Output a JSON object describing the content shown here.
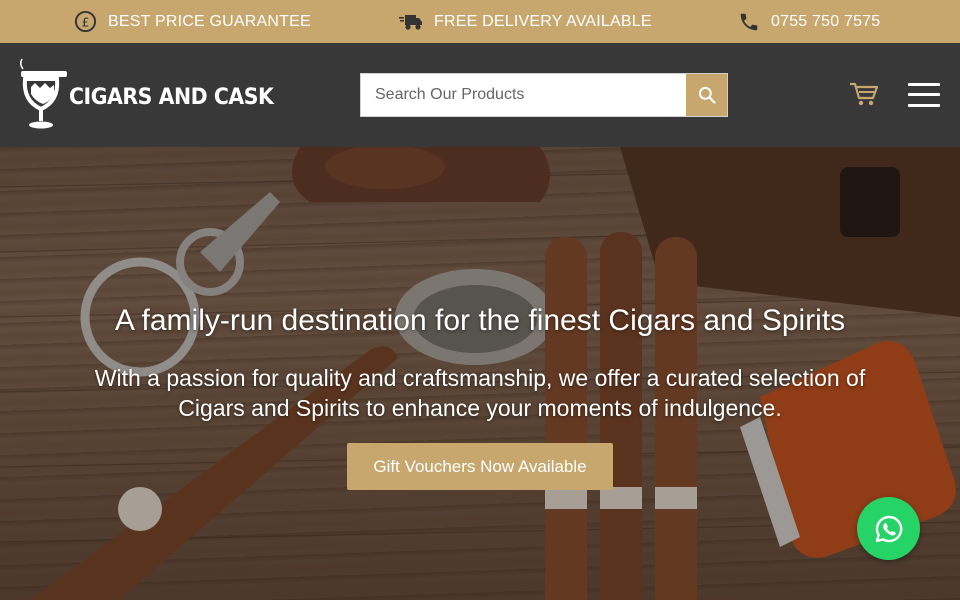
{
  "promo_bar": {
    "guarantee": "BEST PRICE GUARANTEE",
    "delivery": "FREE DELIVERY AVAILABLE",
    "phone": "0755 750 7575",
    "background": "#c7a76e"
  },
  "header": {
    "logo_text": "CIGARS AND CASK",
    "search_placeholder": "Search Our Products",
    "background": "#383838",
    "accent": "#c7a76e",
    "icons": [
      "search-icon",
      "cart-icon",
      "hamburger-menu-icon"
    ]
  },
  "hero": {
    "title": "A family-run destination for the finest Cigars and Spirits",
    "subtitle": "With a passion for quality and craftsmanship, we offer a curated selection of Cigars and Spirits to enhance your moments of indulgence.",
    "cta_label": "Gift Vouchers Now Available"
  },
  "floating": {
    "whatsapp_color": "#25d366",
    "icon": "whatsapp-icon"
  }
}
